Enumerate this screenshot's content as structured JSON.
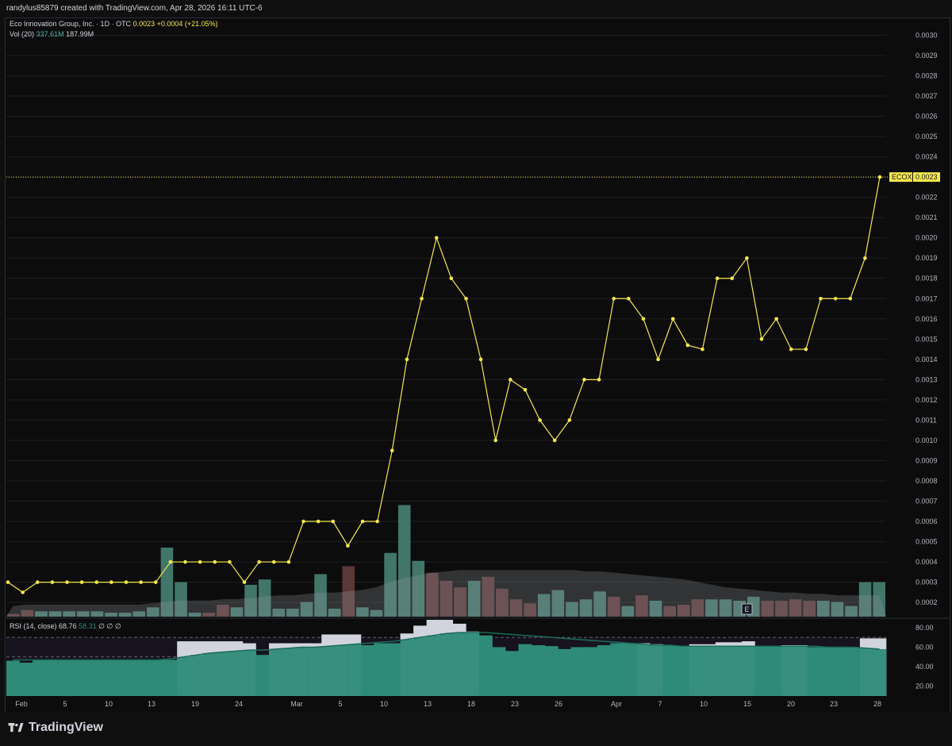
{
  "header": {
    "credit": "randylus85879 created with TradingView.com, Apr 28, 2026 16:11 UTC-6"
  },
  "legend": {
    "symbol": "Eco Innovation Group, Inc. · 1D · OTC",
    "price": "0.0023",
    "change": "+0.0004 (+21.05%)",
    "vol_label": "Vol (20)",
    "vol_value": "337.61M",
    "vol_ma": "187.99M"
  },
  "rsi_legend": {
    "label": "RSI (14, close)",
    "value": "68.76",
    "ma": "58.31",
    "extra": "∅ ∅ ∅"
  },
  "price_tag": {
    "ticker": "ECOX",
    "value": "0.0023"
  },
  "earnings_marker": "E",
  "logo": {
    "text": "TradingView"
  },
  "colors": {
    "line": "#f5e84c",
    "up_vol": "#4b8a7a",
    "down_vol": "#6b3f3f",
    "rsi_fill": "#2e8b78",
    "grid": "#1e1e1e"
  },
  "chart_data": [
    {
      "type": "line",
      "series_label": "Eco Innovation Group, Inc. · 1D · OTC",
      "x": [
        "Jan 30",
        "Feb 2",
        "Feb 3",
        "Feb 4",
        "Feb 5",
        "Feb 6",
        "Feb 9",
        "Feb 10",
        "Feb 11",
        "Feb 12",
        "Feb 13",
        "Feb 17",
        "Feb 18",
        "Feb 19",
        "Feb 20",
        "Feb 23",
        "Feb 24",
        "Feb 25",
        "Feb 26",
        "Feb 27",
        "Mar 2",
        "Mar 3",
        "Mar 4",
        "Mar 5",
        "Mar 6",
        "Mar 9",
        "Mar 10",
        "Mar 11",
        "Mar 12",
        "Mar 13",
        "Mar 16",
        "Mar 17",
        "Mar 18",
        "Mar 19",
        "Mar 20",
        "Mar 23",
        "Mar 24",
        "Mar 25",
        "Mar 26",
        "Mar 27",
        "Mar 30",
        "Mar 31",
        "Apr 1",
        "Apr 2",
        "Apr 6",
        "Apr 7",
        "Apr 8",
        "Apr 9",
        "Apr 10",
        "Apr 13",
        "Apr 14",
        "Apr 15",
        "Apr 16",
        "Apr 17",
        "Apr 20",
        "Apr 21",
        "Apr 22",
        "Apr 23",
        "Apr 24",
        "Apr 27",
        "Apr 28"
      ],
      "values": [
        0.0003,
        0.00025,
        0.0003,
        0.0003,
        0.0003,
        0.0003,
        0.0003,
        0.0003,
        0.0003,
        0.0003,
        0.0003,
        0.0004,
        0.0004,
        0.0004,
        0.0004,
        0.0004,
        0.0003,
        0.0004,
        0.0004,
        0.0004,
        0.0006,
        0.0006,
        0.0006,
        0.00048,
        0.0006,
        0.0006,
        0.00095,
        0.0014,
        0.0017,
        0.002,
        0.0018,
        0.0017,
        0.0014,
        0.001,
        0.0013,
        0.00125,
        0.0011,
        0.001,
        0.0011,
        0.0013,
        0.0013,
        0.0017,
        0.0017,
        0.0016,
        0.0014,
        0.0016,
        0.00147,
        0.00145,
        0.0018,
        0.0018,
        0.0019,
        0.0015,
        0.0016,
        0.00145,
        0.00145,
        0.0017,
        0.0017,
        0.0017,
        0.0019,
        0.0023
      ],
      "y_ticks": [
        "0.0002",
        "0.0003",
        "0.0004",
        "0.0005",
        "0.0006",
        "0.0007",
        "0.0008",
        "0.0009",
        "0.0010",
        "0.0011",
        "0.0012",
        "0.0013",
        "0.0014",
        "0.0015",
        "0.0016",
        "0.0017",
        "0.0018",
        "0.0019",
        "0.0020",
        "0.0021",
        "0.0022",
        "0.0023",
        "0.0024",
        "0.0025",
        "0.0026",
        "0.0027",
        "0.0028",
        "0.0029",
        "0.0030"
      ],
      "ylim": [
        0.00013,
        0.00308
      ],
      "x_ticks": [
        "Feb",
        "5",
        "10",
        "13",
        "19",
        "24",
        "Mar",
        "5",
        "10",
        "13",
        "18",
        "23",
        "26",
        "Apr",
        "7",
        "10",
        "15",
        "20",
        "23",
        "28"
      ]
    },
    {
      "type": "bar",
      "series_label": "Vol (20)",
      "values": [
        2,
        5,
        4,
        4,
        4,
        4,
        4,
        3,
        3,
        4,
        7,
        52,
        26,
        3,
        3,
        9,
        7,
        24,
        28,
        6,
        6,
        11,
        32,
        6,
        38,
        7,
        5,
        48,
        84,
        42,
        33,
        27,
        22,
        27,
        30,
        21,
        13,
        10,
        17,
        20,
        11,
        13,
        19,
        15,
        8,
        16,
        12,
        8,
        9,
        13,
        13,
        13,
        12,
        15,
        12,
        12,
        13,
        12,
        12,
        11,
        8,
        26,
        26
      ],
      "direction": [
        "d",
        "d",
        "u",
        "u",
        "u",
        "u",
        "u",
        "u",
        "u",
        "u",
        "u",
        "u",
        "u",
        "u",
        "d",
        "d",
        "u",
        "u",
        "u",
        "u",
        "u",
        "u",
        "u",
        "u",
        "d",
        "u",
        "u",
        "u",
        "u",
        "u",
        "d",
        "d",
        "d",
        "u",
        "d",
        "d",
        "d",
        "d",
        "u",
        "u",
        "u",
        "u",
        "u",
        "d",
        "u",
        "d",
        "u",
        "d",
        "d",
        "d",
        "u",
        "u",
        "u",
        "u",
        "d",
        "d",
        "d",
        "d",
        "u",
        "u",
        "u",
        "u"
      ],
      "ma": [
        8,
        9,
        9,
        9,
        9,
        9,
        9,
        9,
        9,
        9,
        10,
        11,
        12,
        12,
        12,
        13,
        13,
        14,
        15,
        16,
        16,
        17,
        18,
        18,
        19,
        20,
        22,
        26,
        29,
        31,
        33,
        34,
        35,
        35,
        35,
        35,
        35,
        35,
        35,
        35,
        35,
        34,
        34,
        33,
        32,
        31,
        30,
        29,
        28,
        26,
        24,
        22,
        21,
        20,
        19,
        18,
        18,
        17,
        17,
        16,
        16,
        16,
        16
      ],
      "ylim": [
        0,
        90
      ]
    },
    {
      "type": "area",
      "series_label": "RSI (14, close)",
      "y_ticks": [
        "20.00",
        "40.00",
        "60.00",
        "80.00"
      ],
      "levels": [
        30,
        50,
        70
      ],
      "ylim": [
        10,
        88
      ],
      "rsi": [
        46,
        44,
        47,
        47,
        47,
        47,
        47,
        47,
        47,
        47,
        47,
        47,
        47,
        66,
        66,
        66,
        66,
        66,
        64,
        52,
        64,
        64,
        64,
        64,
        73,
        73,
        73,
        62,
        64,
        64,
        74,
        82,
        88,
        88,
        84,
        76,
        72,
        60,
        56,
        63,
        62,
        61,
        58,
        60,
        60,
        62,
        64,
        64,
        64,
        63,
        62,
        61,
        63,
        63,
        65,
        65,
        66,
        61,
        61,
        62,
        62,
        60,
        60,
        60,
        60,
        69,
        69
      ],
      "ma": [
        47,
        47,
        47,
        47,
        47,
        47,
        47,
        47,
        47,
        47,
        47,
        47,
        48,
        50,
        52,
        54,
        55,
        56,
        57,
        57,
        58,
        59,
        60,
        60,
        61,
        62,
        63,
        64,
        65,
        66,
        68,
        70,
        72,
        74,
        75,
        75,
        75,
        74,
        73,
        72,
        71,
        70,
        69,
        68,
        67,
        66,
        65,
        64,
        63,
        62,
        62,
        61,
        61,
        61,
        61,
        61,
        61,
        61,
        61,
        61,
        61,
        61,
        60,
        60,
        60,
        59,
        58
      ]
    }
  ]
}
